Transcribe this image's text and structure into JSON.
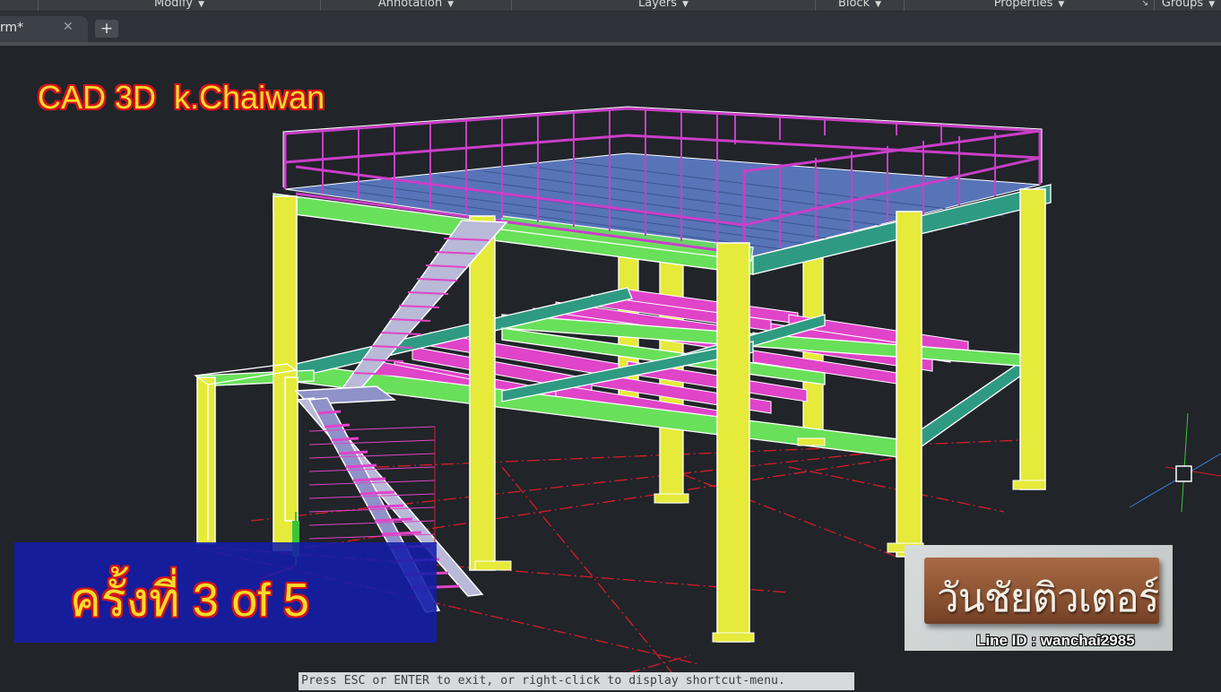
{
  "ribbon": {
    "panels": [
      {
        "label": "Modify",
        "has_dropdown": true
      },
      {
        "label": "Annotation",
        "has_dropdown": true
      },
      {
        "label": "Layers",
        "has_dropdown": true
      },
      {
        "label": "Block",
        "has_dropdown": true
      },
      {
        "label": "Properties",
        "has_dropdown": true
      },
      {
        "label": "Groups",
        "has_dropdown": true
      }
    ],
    "launcher_icon": "panel-launcher-arrow-icon"
  },
  "file_tabs": {
    "active_tab": "rm*",
    "close_icon": "close-icon",
    "add_icon": "plus-icon"
  },
  "viewport": {
    "title_overlay": "CAD 3D  k.Chaiwan",
    "episode_label": "ครั้งที่ 3 of 5",
    "brand_name": "วันชัยติวเตอร์",
    "brand_contact": "Line ID : wanchai2985",
    "ucs_icon": "ucs-axis-icon"
  },
  "command_prompt": "Press ESC or ENTER to exit, or right-click to display shortcut-menu.",
  "colors": {
    "background": "#21252c",
    "column": "#e6ea3a",
    "beam_green": "#69e05a",
    "beam_teal": "#2f9a82",
    "joist_magenta": "#e044c8",
    "deck_blue": "#5874b8",
    "railing": "#c93fc8",
    "ground_grid": "#d41e2b",
    "overlay_text": "#f6dc2a",
    "overlay_outline": "#d4121b",
    "episode_bg": "#141caa"
  }
}
